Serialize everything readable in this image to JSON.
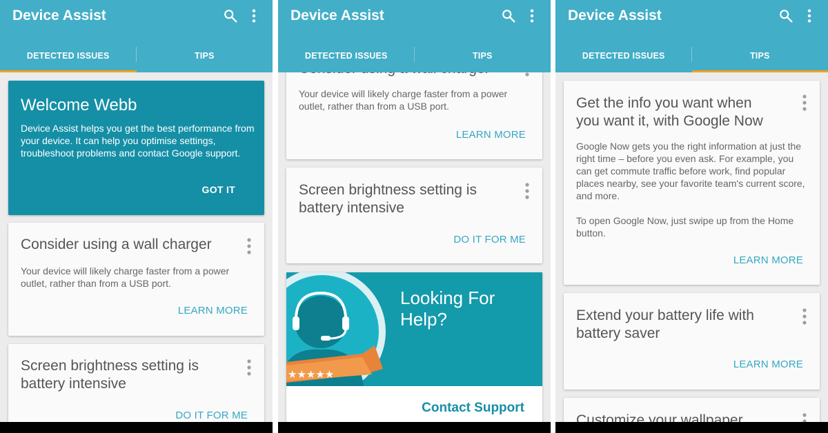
{
  "app": {
    "title": "Device Assist"
  },
  "icons": {
    "search": "search-icon",
    "menu": "more-vert-icon"
  },
  "colors": {
    "appbar": "#42aec7",
    "tab_indicator": "#f4a11d",
    "welcome_card": "#158fa6",
    "action_text": "#35a7c3"
  },
  "tabs": {
    "detected": "DETECTED ISSUES",
    "tips": "TIPS"
  },
  "screen1": {
    "welcome": {
      "title": "Welcome Webb",
      "body": "Device Assist helps you get the best performance from your device. It can help you optimise settings, troubleshoot problems and contact Google support.",
      "action": "GOT IT"
    },
    "charger": {
      "title": "Consider using a wall charger",
      "body": "Your device will likely charge faster from a power outlet, rather than from a USB port.",
      "action": "LEARN MORE"
    },
    "brightness": {
      "title": "Screen brightness setting is battery intensive",
      "action": "DO IT FOR ME"
    }
  },
  "screen2": {
    "charger": {
      "title": "Consider using a wall charger",
      "body": "Your device will likely charge faster from a power outlet, rather than from a USB port.",
      "action": "LEARN MORE"
    },
    "brightness": {
      "title": "Screen brightness setting is battery intensive",
      "action": "DO IT FOR ME"
    },
    "help": {
      "title": "Looking For Help?",
      "action": "Contact Support"
    }
  },
  "screen3": {
    "google_now": {
      "title": "Get the info you want when you want it, with Google Now",
      "body1": "Google Now gets you the right information at just the right time – before you even ask. For example, you can get commute traffic before work, find popular places nearby, see your favorite team's current score, and more.",
      "body2": "To open Google Now, just swipe up from the Home button.",
      "action": "LEARN MORE"
    },
    "battery_saver": {
      "title": "Extend your battery life with battery saver",
      "action": "LEARN MORE"
    },
    "wallpaper": {
      "title": "Customize your wallpaper"
    }
  }
}
